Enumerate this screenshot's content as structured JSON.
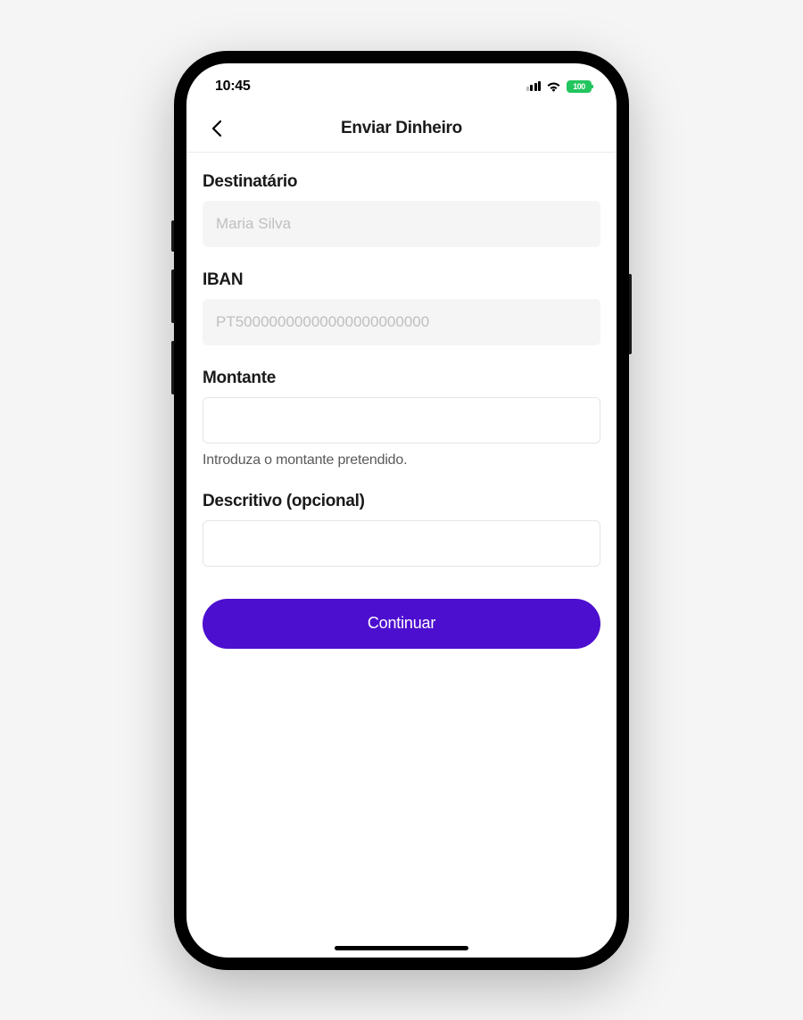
{
  "statusBar": {
    "time": "10:45",
    "battery": "100"
  },
  "header": {
    "title": "Enviar Dinheiro"
  },
  "form": {
    "recipient": {
      "label": "Destinatário",
      "value": "Maria Silva"
    },
    "iban": {
      "label": "IBAN",
      "value": "PT50000000000000000000000"
    },
    "amount": {
      "label": "Montante",
      "helper": "Introduza o montante pretendido."
    },
    "description": {
      "label": "Descritivo (opcional)"
    },
    "submit": "Continuar"
  }
}
